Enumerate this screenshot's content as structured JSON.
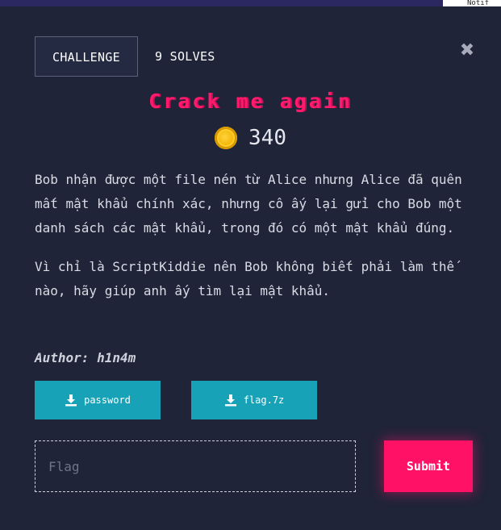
{
  "topbar": {
    "corner_text": "Notif"
  },
  "tabs": [
    {
      "label": "CHALLENGE",
      "active": true
    },
    {
      "label": "9 SOLVES",
      "active": false
    }
  ],
  "close_icon": "close-icon",
  "challenge": {
    "title": "Crack me again",
    "points": "340",
    "points_icon": "coin-icon",
    "description": [
      "Bob nhận được một file nén từ Alice nhưng Alice đã quên mất mật khẩu chính xác, nhưng cô ấy lại gửi cho Bob một danh sách các mật khẩu, trong đó có một mật khẩu đúng.",
      "Vì chỉ là ScriptKiddie nên Bob không biết phải làm thế nào, hãy giúp anh ấy tìm lại mật khẩu."
    ],
    "author": "Author: h1n4m"
  },
  "files": [
    {
      "label": "password",
      "icon": "download-icon"
    },
    {
      "label": "flag.7z",
      "icon": "download-icon"
    }
  ],
  "flag_form": {
    "placeholder": "Flag",
    "value": "",
    "submit_label": "Submit"
  },
  "colors": {
    "background": "#1f2439",
    "accent": "#ff1266",
    "download_button": "#17a2b8",
    "coin": "#f1b400"
  }
}
